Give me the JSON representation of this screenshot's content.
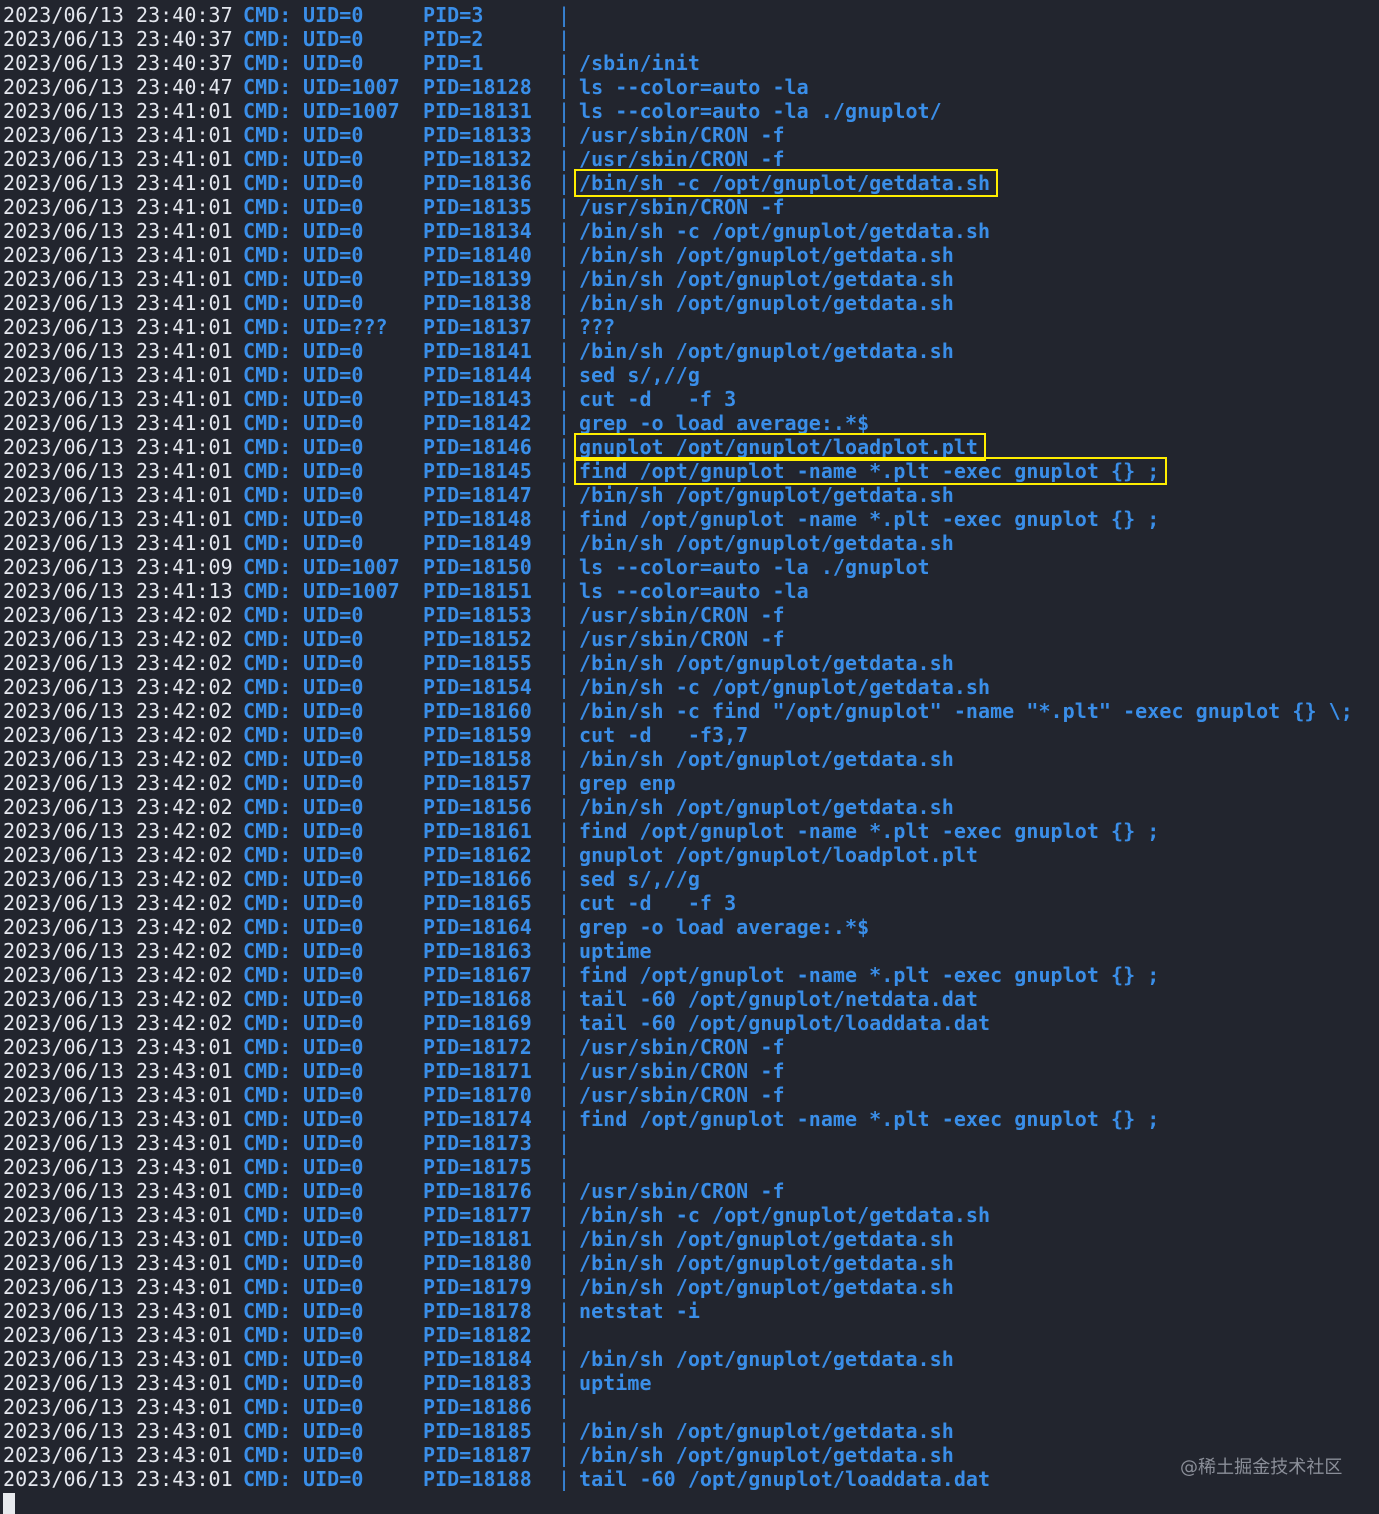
{
  "cmd_label": "CMD:",
  "separator": "|",
  "watermark": "@稀土掘金技术社区",
  "colors": {
    "background": "#22252e",
    "timestamp": "#e4e7ee",
    "process_text": "#3a8ee8",
    "highlight_box": "#ffee00"
  },
  "rows": [
    {
      "ts": "2023/06/13 23:40:37",
      "uid": "UID=0",
      "pid": "PID=3",
      "proc": ""
    },
    {
      "ts": "2023/06/13 23:40:37",
      "uid": "UID=0",
      "pid": "PID=2",
      "proc": ""
    },
    {
      "ts": "2023/06/13 23:40:37",
      "uid": "UID=0",
      "pid": "PID=1",
      "proc": "/sbin/init"
    },
    {
      "ts": "2023/06/13 23:40:47",
      "uid": "UID=1007",
      "pid": "PID=18128",
      "proc": "ls --color=auto -la"
    },
    {
      "ts": "2023/06/13 23:41:01",
      "uid": "UID=1007",
      "pid": "PID=18131",
      "proc": "ls --color=auto -la ./gnuplot/"
    },
    {
      "ts": "2023/06/13 23:41:01",
      "uid": "UID=0",
      "pid": "PID=18133",
      "proc": "/usr/sbin/CRON -f"
    },
    {
      "ts": "2023/06/13 23:41:01",
      "uid": "UID=0",
      "pid": "PID=18132",
      "proc": "/usr/sbin/CRON -f"
    },
    {
      "ts": "2023/06/13 23:41:01",
      "uid": "UID=0",
      "pid": "PID=18136",
      "proc": "/bin/sh -c /opt/gnuplot/getdata.sh",
      "highlight": true
    },
    {
      "ts": "2023/06/13 23:41:01",
      "uid": "UID=0",
      "pid": "PID=18135",
      "proc": "/usr/sbin/CRON -f"
    },
    {
      "ts": "2023/06/13 23:41:01",
      "uid": "UID=0",
      "pid": "PID=18134",
      "proc": "/bin/sh -c /opt/gnuplot/getdata.sh"
    },
    {
      "ts": "2023/06/13 23:41:01",
      "uid": "UID=0",
      "pid": "PID=18140",
      "proc": "/bin/sh /opt/gnuplot/getdata.sh"
    },
    {
      "ts": "2023/06/13 23:41:01",
      "uid": "UID=0",
      "pid": "PID=18139",
      "proc": "/bin/sh /opt/gnuplot/getdata.sh"
    },
    {
      "ts": "2023/06/13 23:41:01",
      "uid": "UID=0",
      "pid": "PID=18138",
      "proc": "/bin/sh /opt/gnuplot/getdata.sh"
    },
    {
      "ts": "2023/06/13 23:41:01",
      "uid": "UID=???",
      "pid": "PID=18137",
      "proc": "???"
    },
    {
      "ts": "2023/06/13 23:41:01",
      "uid": "UID=0",
      "pid": "PID=18141",
      "proc": "/bin/sh /opt/gnuplot/getdata.sh"
    },
    {
      "ts": "2023/06/13 23:41:01",
      "uid": "UID=0",
      "pid": "PID=18144",
      "proc": "sed s/,//g"
    },
    {
      "ts": "2023/06/13 23:41:01",
      "uid": "UID=0",
      "pid": "PID=18143",
      "proc": "cut -d   -f 3"
    },
    {
      "ts": "2023/06/13 23:41:01",
      "uid": "UID=0",
      "pid": "PID=18142",
      "proc": "grep -o load average:.*$"
    },
    {
      "ts": "2023/06/13 23:41:01",
      "uid": "UID=0",
      "pid": "PID=18146",
      "proc": "gnuplot /opt/gnuplot/loadplot.plt",
      "highlight": true
    },
    {
      "ts": "2023/06/13 23:41:01",
      "uid": "UID=0",
      "pid": "PID=18145",
      "proc": "find /opt/gnuplot -name *.plt -exec gnuplot {} ;",
      "highlight": true
    },
    {
      "ts": "2023/06/13 23:41:01",
      "uid": "UID=0",
      "pid": "PID=18147",
      "proc": "/bin/sh /opt/gnuplot/getdata.sh"
    },
    {
      "ts": "2023/06/13 23:41:01",
      "uid": "UID=0",
      "pid": "PID=18148",
      "proc": "find /opt/gnuplot -name *.plt -exec gnuplot {} ;"
    },
    {
      "ts": "2023/06/13 23:41:01",
      "uid": "UID=0",
      "pid": "PID=18149",
      "proc": "/bin/sh /opt/gnuplot/getdata.sh"
    },
    {
      "ts": "2023/06/13 23:41:09",
      "uid": "UID=1007",
      "pid": "PID=18150",
      "proc": "ls --color=auto -la ./gnuplot"
    },
    {
      "ts": "2023/06/13 23:41:13",
      "uid": "UID=1007",
      "pid": "PID=18151",
      "proc": "ls --color=auto -la"
    },
    {
      "ts": "2023/06/13 23:42:02",
      "uid": "UID=0",
      "pid": "PID=18153",
      "proc": "/usr/sbin/CRON -f"
    },
    {
      "ts": "2023/06/13 23:42:02",
      "uid": "UID=0",
      "pid": "PID=18152",
      "proc": "/usr/sbin/CRON -f"
    },
    {
      "ts": "2023/06/13 23:42:02",
      "uid": "UID=0",
      "pid": "PID=18155",
      "proc": "/bin/sh /opt/gnuplot/getdata.sh"
    },
    {
      "ts": "2023/06/13 23:42:02",
      "uid": "UID=0",
      "pid": "PID=18154",
      "proc": "/bin/sh -c /opt/gnuplot/getdata.sh"
    },
    {
      "ts": "2023/06/13 23:42:02",
      "uid": "UID=0",
      "pid": "PID=18160",
      "proc": "/bin/sh -c find \"/opt/gnuplot\" -name \"*.plt\" -exec gnuplot {} \\;"
    },
    {
      "ts": "2023/06/13 23:42:02",
      "uid": "UID=0",
      "pid": "PID=18159",
      "proc": "cut -d   -f3,7"
    },
    {
      "ts": "2023/06/13 23:42:02",
      "uid": "UID=0",
      "pid": "PID=18158",
      "proc": "/bin/sh /opt/gnuplot/getdata.sh"
    },
    {
      "ts": "2023/06/13 23:42:02",
      "uid": "UID=0",
      "pid": "PID=18157",
      "proc": "grep enp"
    },
    {
      "ts": "2023/06/13 23:42:02",
      "uid": "UID=0",
      "pid": "PID=18156",
      "proc": "/bin/sh /opt/gnuplot/getdata.sh"
    },
    {
      "ts": "2023/06/13 23:42:02",
      "uid": "UID=0",
      "pid": "PID=18161",
      "proc": "find /opt/gnuplot -name *.plt -exec gnuplot {} ;"
    },
    {
      "ts": "2023/06/13 23:42:02",
      "uid": "UID=0",
      "pid": "PID=18162",
      "proc": "gnuplot /opt/gnuplot/loadplot.plt"
    },
    {
      "ts": "2023/06/13 23:42:02",
      "uid": "UID=0",
      "pid": "PID=18166",
      "proc": "sed s/,//g"
    },
    {
      "ts": "2023/06/13 23:42:02",
      "uid": "UID=0",
      "pid": "PID=18165",
      "proc": "cut -d   -f 3"
    },
    {
      "ts": "2023/06/13 23:42:02",
      "uid": "UID=0",
      "pid": "PID=18164",
      "proc": "grep -o load average:.*$"
    },
    {
      "ts": "2023/06/13 23:42:02",
      "uid": "UID=0",
      "pid": "PID=18163",
      "proc": "uptime"
    },
    {
      "ts": "2023/06/13 23:42:02",
      "uid": "UID=0",
      "pid": "PID=18167",
      "proc": "find /opt/gnuplot -name *.plt -exec gnuplot {} ;"
    },
    {
      "ts": "2023/06/13 23:42:02",
      "uid": "UID=0",
      "pid": "PID=18168",
      "proc": "tail -60 /opt/gnuplot/netdata.dat"
    },
    {
      "ts": "2023/06/13 23:42:02",
      "uid": "UID=0",
      "pid": "PID=18169",
      "proc": "tail -60 /opt/gnuplot/loaddata.dat"
    },
    {
      "ts": "2023/06/13 23:43:01",
      "uid": "UID=0",
      "pid": "PID=18172",
      "proc": "/usr/sbin/CRON -f"
    },
    {
      "ts": "2023/06/13 23:43:01",
      "uid": "UID=0",
      "pid": "PID=18171",
      "proc": "/usr/sbin/CRON -f"
    },
    {
      "ts": "2023/06/13 23:43:01",
      "uid": "UID=0",
      "pid": "PID=18170",
      "proc": "/usr/sbin/CRON -f"
    },
    {
      "ts": "2023/06/13 23:43:01",
      "uid": "UID=0",
      "pid": "PID=18174",
      "proc": "find /opt/gnuplot -name *.plt -exec gnuplot {} ;"
    },
    {
      "ts": "2023/06/13 23:43:01",
      "uid": "UID=0",
      "pid": "PID=18173",
      "proc": ""
    },
    {
      "ts": "2023/06/13 23:43:01",
      "uid": "UID=0",
      "pid": "PID=18175",
      "proc": ""
    },
    {
      "ts": "2023/06/13 23:43:01",
      "uid": "UID=0",
      "pid": "PID=18176",
      "proc": "/usr/sbin/CRON -f"
    },
    {
      "ts": "2023/06/13 23:43:01",
      "uid": "UID=0",
      "pid": "PID=18177",
      "proc": "/bin/sh -c /opt/gnuplot/getdata.sh"
    },
    {
      "ts": "2023/06/13 23:43:01",
      "uid": "UID=0",
      "pid": "PID=18181",
      "proc": "/bin/sh /opt/gnuplot/getdata.sh"
    },
    {
      "ts": "2023/06/13 23:43:01",
      "uid": "UID=0",
      "pid": "PID=18180",
      "proc": "/bin/sh /opt/gnuplot/getdata.sh"
    },
    {
      "ts": "2023/06/13 23:43:01",
      "uid": "UID=0",
      "pid": "PID=18179",
      "proc": "/bin/sh /opt/gnuplot/getdata.sh"
    },
    {
      "ts": "2023/06/13 23:43:01",
      "uid": "UID=0",
      "pid": "PID=18178",
      "proc": "netstat -i"
    },
    {
      "ts": "2023/06/13 23:43:01",
      "uid": "UID=0",
      "pid": "PID=18182",
      "proc": ""
    },
    {
      "ts": "2023/06/13 23:43:01",
      "uid": "UID=0",
      "pid": "PID=18184",
      "proc": "/bin/sh /opt/gnuplot/getdata.sh"
    },
    {
      "ts": "2023/06/13 23:43:01",
      "uid": "UID=0",
      "pid": "PID=18183",
      "proc": "uptime"
    },
    {
      "ts": "2023/06/13 23:43:01",
      "uid": "UID=0",
      "pid": "PID=18186",
      "proc": ""
    },
    {
      "ts": "2023/06/13 23:43:01",
      "uid": "UID=0",
      "pid": "PID=18185",
      "proc": "/bin/sh /opt/gnuplot/getdata.sh"
    },
    {
      "ts": "2023/06/13 23:43:01",
      "uid": "UID=0",
      "pid": "PID=18187",
      "proc": "/bin/sh /opt/gnuplot/getdata.sh"
    },
    {
      "ts": "2023/06/13 23:43:01",
      "uid": "UID=0",
      "pid": "PID=18188",
      "proc": "tail -60 /opt/gnuplot/loaddata.dat"
    }
  ]
}
